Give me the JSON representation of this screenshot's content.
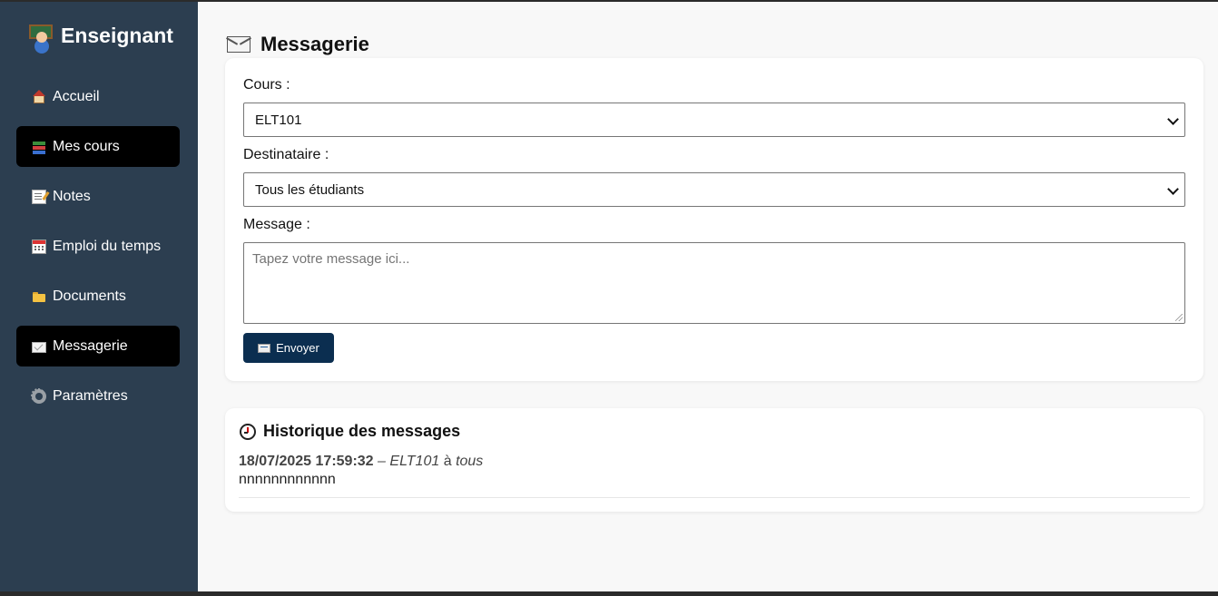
{
  "sidebar": {
    "brand": "Enseignant",
    "brand_icon": "teacher-icon",
    "items": [
      {
        "label": "Accueil",
        "icon": "house-icon",
        "active": false
      },
      {
        "label": "Mes cours",
        "icon": "books-icon",
        "active": true
      },
      {
        "label": "Notes",
        "icon": "memo-icon",
        "active": false
      },
      {
        "label": "Emploi du temps",
        "icon": "calendar-icon",
        "active": false
      },
      {
        "label": "Documents",
        "icon": "folder-icon",
        "active": false
      },
      {
        "label": "Messagerie",
        "icon": "envelope-icon",
        "active": true
      },
      {
        "label": "Paramètres",
        "icon": "gear-icon",
        "active": false
      }
    ],
    "bg_color": "#2c3e50",
    "active_color": "#000000"
  },
  "main": {
    "title": "Messagerie",
    "form": {
      "course_label": "Cours :",
      "course_value": "ELT101",
      "recipient_label": "Destinataire :",
      "recipient_value": "Tous les étudiants",
      "message_label": "Message :",
      "message_placeholder": "Tapez votre message ici...",
      "message_value": "",
      "send_label": "Envoyer",
      "send_color": "#0b2e50"
    },
    "history": {
      "title": "Historique des messages",
      "messages": [
        {
          "timestamp": "18/07/2025 17:59:32",
          "separator": "–",
          "course": "ELT101",
          "to_word": "à",
          "recipient": "tous",
          "body": "nnnnnnnnnnnn"
        }
      ]
    }
  }
}
